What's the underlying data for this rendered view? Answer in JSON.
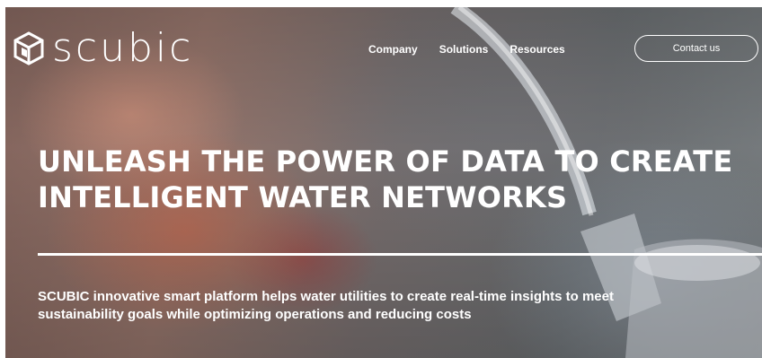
{
  "brand": {
    "name": "scubic",
    "logo_icon": "cube-icon"
  },
  "nav": {
    "items": [
      "Company",
      "Solutions",
      "Resources"
    ]
  },
  "contact": {
    "label": "Contact us"
  },
  "hero": {
    "headline_line1": "UNLEASH THE POWER OF DATA TO CREATE",
    "headline_line2": "INTELLIGENT WATER NETWORKS",
    "subtext_line1": "SCUBIC innovative smart platform helps water utilities to create real-time insights to meet",
    "subtext_line2": "sustainability goals while optimizing operations and reducing costs",
    "background": "hands-under-water-tap-photo"
  },
  "colors": {
    "text": "#ffffff"
  }
}
